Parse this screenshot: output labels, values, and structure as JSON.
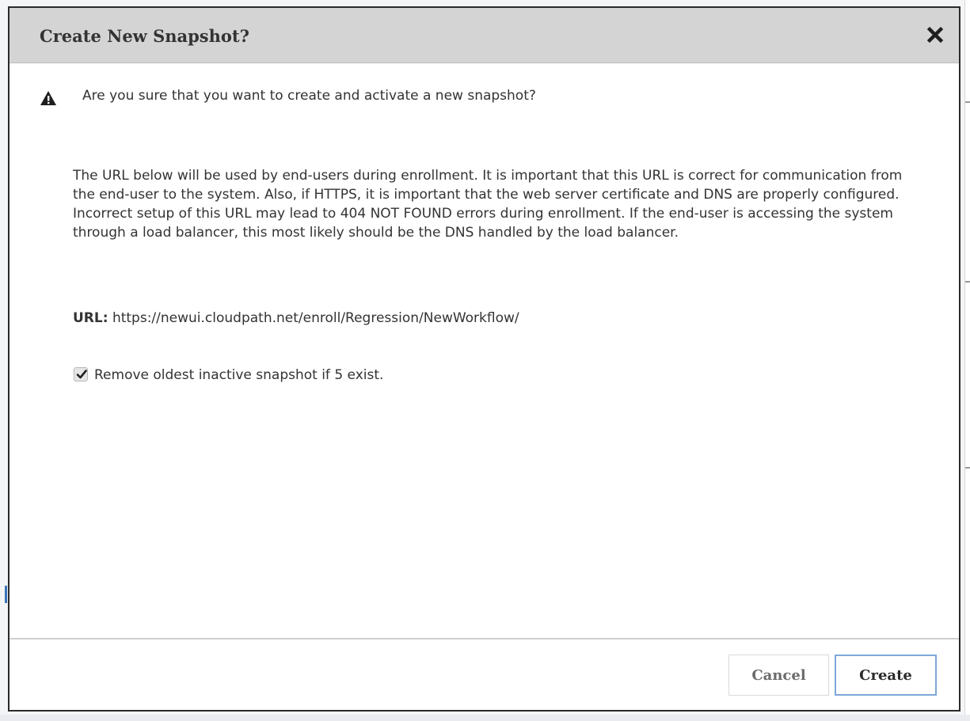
{
  "dialog": {
    "title": "Create New Snapshot?",
    "close_icon": "close-x-icon",
    "warning_icon": "warning-triangle-icon",
    "question": "Are you sure that you want to create and activate a new snapshot?",
    "info_paragraph": "The URL below will be used by end-users during enrollment. It is important that this URL is correct for communication from the end-user to the system. Also, if HTTPS, it is important that the web server certificate and DNS are properly configured. Incorrect setup of this URL may lead to 404 NOT FOUND errors during enrollment. If the end-user is accessing the system through a load balancer, this most likely should be the DNS handled by the load balancer.",
    "url_label": "URL:",
    "url_value": "https://newui.cloudpath.net/enroll/Regression/NewWorkflow/",
    "remove_oldest": {
      "label": "Remove oldest inactive snapshot if 5 exist.",
      "checked": true
    },
    "buttons": {
      "cancel_label": "Cancel",
      "create_label": "Create"
    }
  },
  "colors": {
    "title_bar_bg": "#d4d4d4",
    "dialog_border": "#2a2a2a",
    "text": "#333333",
    "primary_button_border": "#7ea7d8"
  }
}
